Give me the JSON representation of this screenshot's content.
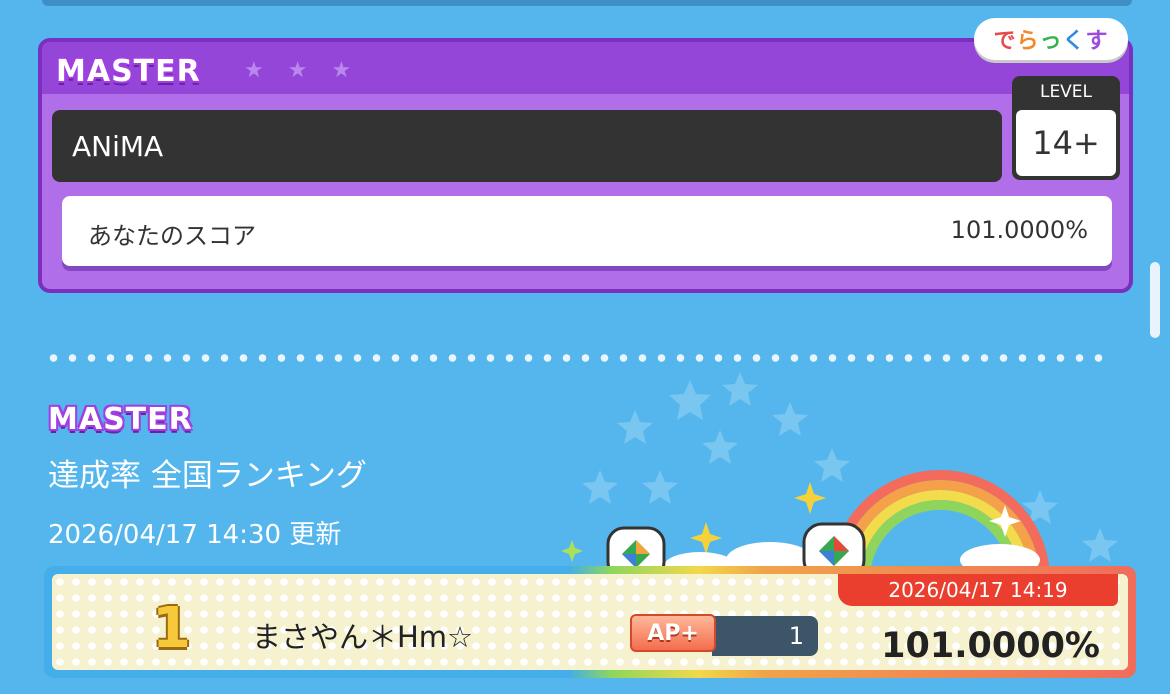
{
  "song": {
    "difficulty": "MASTER",
    "title": "ANiMA",
    "level_label": "LEVEL",
    "level": "14+",
    "score_label": "あなたのスコア",
    "score": "101.0000%"
  },
  "logo": {
    "text": "でらっくす",
    "chars": [
      "で",
      "ら",
      "っ",
      "く",
      "す"
    ]
  },
  "ranking": {
    "difficulty": "MASTER",
    "heading": "達成率 全国ランキング",
    "updated": "2026/04/17 14:30 更新",
    "rows": [
      {
        "rank": "1",
        "name": "まさやん＊Hm☆",
        "ap_label": "AP+",
        "ap_count": "1",
        "date": "2026/04/17 14:19",
        "score": "101.0000%"
      }
    ]
  },
  "colors": {
    "background": "#55b6ee",
    "master_purple": "#9346d7",
    "record_red": "#ea3e2e"
  }
}
